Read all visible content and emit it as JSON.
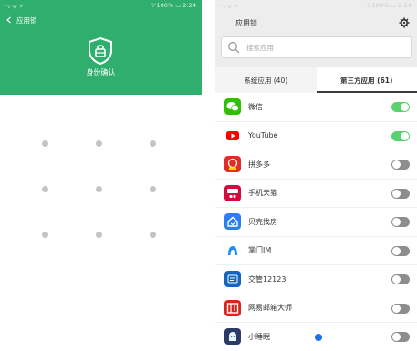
{
  "left": {
    "statusbar": {
      "signal": "ⁿᵢₗ ᯤ ⚡",
      "right": "⅟ 100% ▭ 2:24"
    },
    "title": "应用锁",
    "verify_label": "身份确认",
    "pattern_rows": 3,
    "pattern_cols": 3
  },
  "right": {
    "statusbar": {
      "signal": "ⁿᵢₗ ᯤ ⚡",
      "right": "⅟ 100% ▭ 2:24"
    },
    "title": "应用锁",
    "search_placeholder": "搜索应用",
    "tabs": [
      {
        "label": "系统应用 (40)",
        "active": false
      },
      {
        "label": "第三方应用 (61)",
        "active": true
      }
    ],
    "apps": [
      {
        "name": "微信",
        "locked": true,
        "icon": "wechat-icon",
        "color": "#2dc100"
      },
      {
        "name": "YouTube",
        "locked": true,
        "icon": "youtube-icon",
        "color": "#ff0000"
      },
      {
        "name": "拼多多",
        "locked": false,
        "icon": "pinduoduo-icon",
        "color": "#e02e24"
      },
      {
        "name": "手机天猫",
        "locked": false,
        "icon": "tmall-icon",
        "color": "#d6083c"
      },
      {
        "name": "贝壳找房",
        "locked": false,
        "icon": "beike-icon",
        "color": "#2e7cf6"
      },
      {
        "name": "掌门IM",
        "locked": false,
        "icon": "zhangmen-icon",
        "color": "#1f8ef1"
      },
      {
        "name": "交管12123",
        "locked": false,
        "icon": "jiaoguan-icon",
        "color": "#1565c0"
      },
      {
        "name": "网易邮箱大师",
        "locked": false,
        "icon": "netease-mail-icon",
        "color": "#d9241b"
      },
      {
        "name": "小睡眠",
        "locked": false,
        "icon": "xiaoshuimian-icon",
        "color": "#2b3a67"
      }
    ]
  },
  "colors": {
    "hero_green": "#2fae6e",
    "toggle_on": "#5ad16f",
    "toggle_off": "#8d8d8d",
    "touch_indicator": "#1a73e8"
  }
}
